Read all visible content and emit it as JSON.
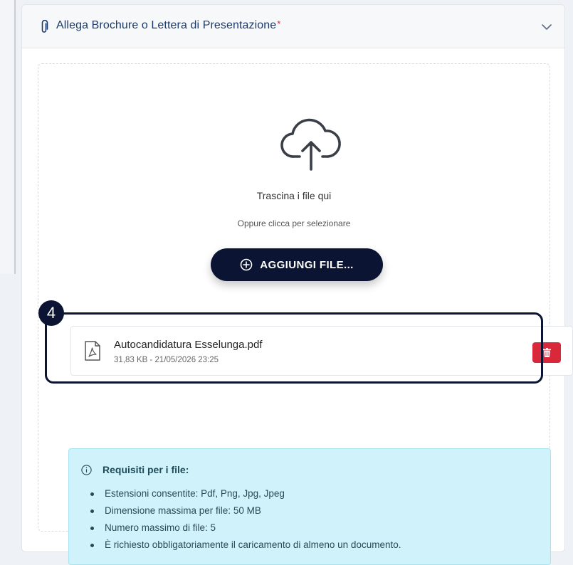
{
  "section": {
    "title": "Allega Brochure o Lettera di Presentazione",
    "required_marker": "*"
  },
  "dropzone": {
    "drag_text": "Trascina i file qui",
    "click_text": "Oppure clicca per selezionare",
    "add_button_label": "AGGIUNGI FILE..."
  },
  "file": {
    "name": "Autocandidatura Esselunga.pdf",
    "meta": "31,83 KB - 21/05/2026 23:25",
    "icon": "pdf-file-icon"
  },
  "annotation": {
    "step_number": "4"
  },
  "requirements": {
    "title": "Requisiti per i file:",
    "items": [
      "Estensioni consentite: Pdf, Png, Jpg, Jpeg",
      "Dimensione massima per file: 50 MB",
      "Numero massimo di file: 5",
      "È richiesto obbligatoriamente il caricamento di almeno un documento."
    ]
  },
  "colors": {
    "primary_dark": "#0b1533",
    "danger": "#d9283a",
    "info_bg": "#cff2fb",
    "header_text": "#1b3a6b"
  }
}
